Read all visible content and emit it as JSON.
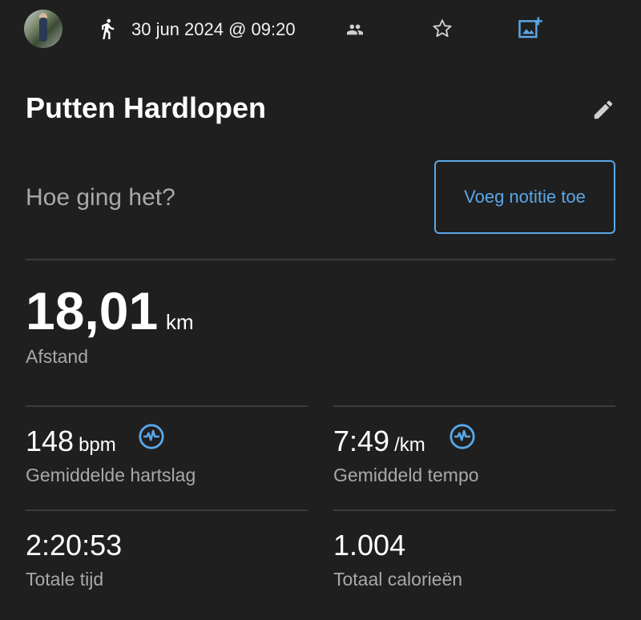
{
  "header": {
    "date_time": "30 jun 2024 @ 09:20",
    "icons": [
      "avatar",
      "running-icon",
      "people-icon",
      "star-icon",
      "add-photo-icon"
    ]
  },
  "activity": {
    "title": "Putten Hardlopen"
  },
  "note": {
    "prompt": "Hoe ging het?",
    "button_label": "Voeg notitie toe"
  },
  "distance": {
    "value": "18,01",
    "unit": "km",
    "label": "Afstand"
  },
  "stats": [
    {
      "value": "148",
      "unit": "bpm",
      "label": "Gemiddelde hartslag",
      "icon": "heart-rate-icon"
    },
    {
      "value": "7:49",
      "unit": "/km",
      "label": "Gemiddeld tempo",
      "icon": "heart-rate-icon"
    },
    {
      "value": "2:20:53",
      "unit": "",
      "label": "Totale tijd"
    },
    {
      "value": "1.004",
      "unit": "",
      "label": "Totaal calorieën"
    }
  ],
  "colors": {
    "background": "#1f1f1f",
    "accent": "#5aa7e8",
    "secondary_text": "#a9a9a9",
    "divider": "#3c3c3c"
  }
}
